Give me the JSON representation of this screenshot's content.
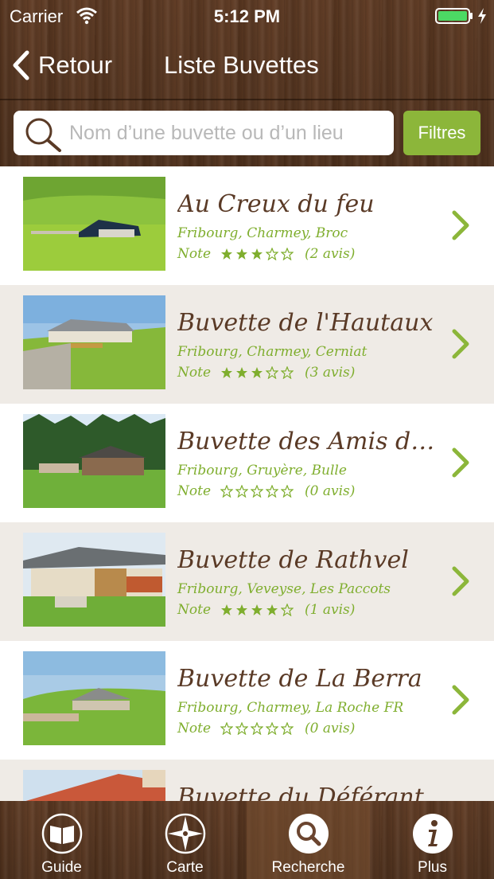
{
  "status": {
    "carrier": "Carrier",
    "time": "5:12 PM",
    "battery_color": "#4cd964"
  },
  "nav": {
    "back_label": "Retour",
    "title": "Liste Buvettes"
  },
  "search": {
    "placeholder": "Nom d’une buvette ou d’un lieu",
    "value": "",
    "filter_label": "Filtres"
  },
  "colors": {
    "accent_green": "#8cb63a",
    "title_brown": "#5a3a26",
    "alt_row_bg": "#efebe6"
  },
  "rating_prefix": "Note",
  "items": [
    {
      "name": "Au Creux du feu",
      "location": "Fribourg, Charmey, Broc",
      "stars": 3,
      "reviews": "(2 avis)"
    },
    {
      "name": "Buvette de l'Hautaux",
      "location": "Fribourg, Charmey, Cerniat",
      "stars": 3,
      "reviews": "(3 avis)"
    },
    {
      "name": "Buvette des Amis de la Nature",
      "location": "Fribourg, Gruyère, Bulle",
      "stars": 0,
      "reviews": "(0 avis)"
    },
    {
      "name": "Buvette de Rathvel",
      "location": "Fribourg, Veveyse, Les Paccots",
      "stars": 4,
      "reviews": "(1 avis)"
    },
    {
      "name": "Buvette de La Berra",
      "location": "Fribourg, Charmey, La Roche FR",
      "stars": 0,
      "reviews": "(0 avis)"
    },
    {
      "name": "Buvette du Déférant",
      "location": "",
      "stars": 0,
      "reviews": ""
    }
  ],
  "tabs": [
    {
      "label": "Guide",
      "icon": "book-icon",
      "active": false
    },
    {
      "label": "Carte",
      "icon": "compass-icon",
      "active": false
    },
    {
      "label": "Recherche",
      "icon": "search-icon",
      "active": true
    },
    {
      "label": "Plus",
      "icon": "info-icon",
      "active": false
    }
  ]
}
